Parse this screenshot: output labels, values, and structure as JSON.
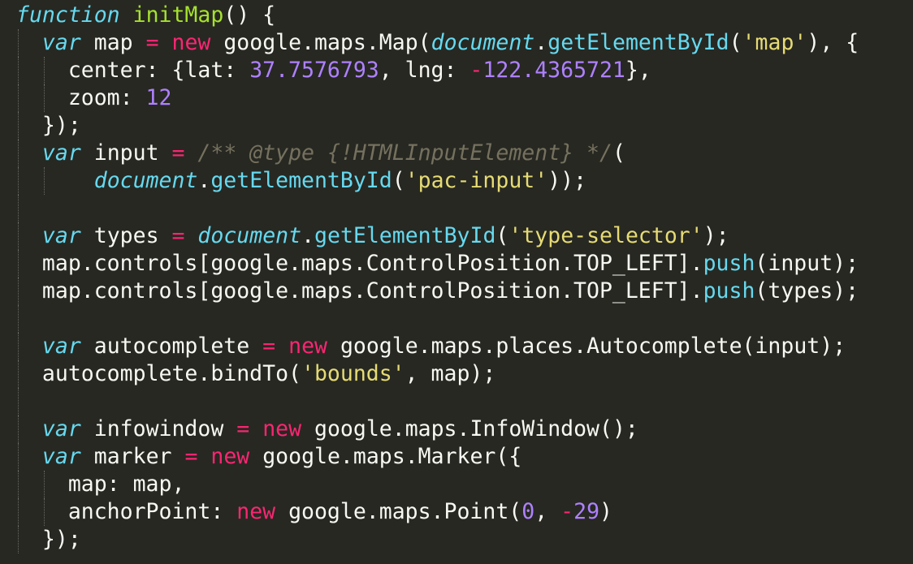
{
  "editor": {
    "theme": {
      "background": "#272822",
      "foreground": "#f8f8f2",
      "keyword": "#66d9ef",
      "function_name": "#a6e22e",
      "operator": "#f92672",
      "number": "#ae81ff",
      "string": "#e6db74",
      "comment": "#75715e"
    },
    "lines": [
      {
        "guides": [],
        "tokens": [
          {
            "t": "function",
            "c": "kw-storage"
          },
          {
            "t": " ",
            "c": "plain"
          },
          {
            "t": "initMap",
            "c": "fn-name"
          },
          {
            "t": "() {",
            "c": "plain"
          }
        ]
      },
      {
        "guides": [
          0
        ],
        "tokens": [
          {
            "t": "  ",
            "c": "plain"
          },
          {
            "t": "var",
            "c": "kw-storage"
          },
          {
            "t": " map ",
            "c": "plain"
          },
          {
            "t": "=",
            "c": "op"
          },
          {
            "t": " ",
            "c": "plain"
          },
          {
            "t": "new",
            "c": "op"
          },
          {
            "t": " google.maps.Map(",
            "c": "plain"
          },
          {
            "t": "document",
            "c": "builtin"
          },
          {
            "t": ".",
            "c": "plain"
          },
          {
            "t": "getElementById",
            "c": "method"
          },
          {
            "t": "(",
            "c": "plain"
          },
          {
            "t": "'map'",
            "c": "str"
          },
          {
            "t": "), {",
            "c": "plain"
          }
        ]
      },
      {
        "guides": [
          0,
          1
        ],
        "tokens": [
          {
            "t": "    center: {lat: ",
            "c": "plain"
          },
          {
            "t": "37.7576793",
            "c": "num"
          },
          {
            "t": ", lng: ",
            "c": "plain"
          },
          {
            "t": "-",
            "c": "op"
          },
          {
            "t": "122.4365721",
            "c": "num"
          },
          {
            "t": "},",
            "c": "plain"
          }
        ]
      },
      {
        "guides": [
          0,
          1
        ],
        "tokens": [
          {
            "t": "    zoom: ",
            "c": "plain"
          },
          {
            "t": "12",
            "c": "num"
          }
        ]
      },
      {
        "guides": [
          0
        ],
        "tokens": [
          {
            "t": "  });",
            "c": "plain"
          }
        ]
      },
      {
        "guides": [
          0
        ],
        "tokens": [
          {
            "t": "  ",
            "c": "plain"
          },
          {
            "t": "var",
            "c": "kw-storage"
          },
          {
            "t": " input ",
            "c": "plain"
          },
          {
            "t": "=",
            "c": "op"
          },
          {
            "t": " ",
            "c": "plain"
          },
          {
            "t": "/** @type {!HTMLInputElement} */",
            "c": "comment"
          },
          {
            "t": "(",
            "c": "plain"
          }
        ]
      },
      {
        "guides": [
          0,
          1
        ],
        "tokens": [
          {
            "t": "      ",
            "c": "plain"
          },
          {
            "t": "document",
            "c": "builtin"
          },
          {
            "t": ".",
            "c": "plain"
          },
          {
            "t": "getElementById",
            "c": "method"
          },
          {
            "t": "(",
            "c": "plain"
          },
          {
            "t": "'pac-input'",
            "c": "str"
          },
          {
            "t": "));",
            "c": "plain"
          }
        ]
      },
      {
        "guides": [
          0
        ],
        "tokens": []
      },
      {
        "guides": [
          0
        ],
        "tokens": [
          {
            "t": "  ",
            "c": "plain"
          },
          {
            "t": "var",
            "c": "kw-storage"
          },
          {
            "t": " types ",
            "c": "plain"
          },
          {
            "t": "=",
            "c": "op"
          },
          {
            "t": " ",
            "c": "plain"
          },
          {
            "t": "document",
            "c": "builtin"
          },
          {
            "t": ".",
            "c": "plain"
          },
          {
            "t": "getElementById",
            "c": "method"
          },
          {
            "t": "(",
            "c": "plain"
          },
          {
            "t": "'type-selector'",
            "c": "str"
          },
          {
            "t": ");",
            "c": "plain"
          }
        ]
      },
      {
        "guides": [
          0
        ],
        "tokens": [
          {
            "t": "  map.controls[google.maps.ControlPosition.TOP_LEFT].",
            "c": "plain"
          },
          {
            "t": "push",
            "c": "method"
          },
          {
            "t": "(input);",
            "c": "plain"
          }
        ]
      },
      {
        "guides": [
          0
        ],
        "tokens": [
          {
            "t": "  map.controls[google.maps.ControlPosition.TOP_LEFT].",
            "c": "plain"
          },
          {
            "t": "push",
            "c": "method"
          },
          {
            "t": "(types);",
            "c": "plain"
          }
        ]
      },
      {
        "guides": [
          0
        ],
        "tokens": []
      },
      {
        "guides": [
          0
        ],
        "tokens": [
          {
            "t": "  ",
            "c": "plain"
          },
          {
            "t": "var",
            "c": "kw-storage"
          },
          {
            "t": " autocomplete ",
            "c": "plain"
          },
          {
            "t": "=",
            "c": "op"
          },
          {
            "t": " ",
            "c": "plain"
          },
          {
            "t": "new",
            "c": "op"
          },
          {
            "t": " google.maps.places.Autocomplete(input);",
            "c": "plain"
          }
        ]
      },
      {
        "guides": [
          0
        ],
        "tokens": [
          {
            "t": "  autocomplete.bindTo(",
            "c": "plain"
          },
          {
            "t": "'bounds'",
            "c": "str"
          },
          {
            "t": ", map);",
            "c": "plain"
          }
        ]
      },
      {
        "guides": [
          0
        ],
        "tokens": []
      },
      {
        "guides": [
          0
        ],
        "tokens": [
          {
            "t": "  ",
            "c": "plain"
          },
          {
            "t": "var",
            "c": "kw-storage"
          },
          {
            "t": " infowindow ",
            "c": "plain"
          },
          {
            "t": "=",
            "c": "op"
          },
          {
            "t": " ",
            "c": "plain"
          },
          {
            "t": "new",
            "c": "op"
          },
          {
            "t": " google.maps.InfoWindow();",
            "c": "plain"
          }
        ]
      },
      {
        "guides": [
          0
        ],
        "tokens": [
          {
            "t": "  ",
            "c": "plain"
          },
          {
            "t": "var",
            "c": "kw-storage"
          },
          {
            "t": " marker ",
            "c": "plain"
          },
          {
            "t": "=",
            "c": "op"
          },
          {
            "t": " ",
            "c": "plain"
          },
          {
            "t": "new",
            "c": "op"
          },
          {
            "t": " google.maps.Marker({",
            "c": "plain"
          }
        ]
      },
      {
        "guides": [
          0,
          1
        ],
        "tokens": [
          {
            "t": "    map: map,",
            "c": "plain"
          }
        ]
      },
      {
        "guides": [
          0,
          1
        ],
        "tokens": [
          {
            "t": "    anchorPoint: ",
            "c": "plain"
          },
          {
            "t": "new",
            "c": "op"
          },
          {
            "t": " google.maps.Point(",
            "c": "plain"
          },
          {
            "t": "0",
            "c": "num"
          },
          {
            "t": ", ",
            "c": "plain"
          },
          {
            "t": "-",
            "c": "op"
          },
          {
            "t": "29",
            "c": "num"
          },
          {
            "t": ")",
            "c": "plain"
          }
        ]
      },
      {
        "guides": [
          0
        ],
        "tokens": [
          {
            "t": "  });",
            "c": "plain"
          }
        ]
      }
    ]
  }
}
